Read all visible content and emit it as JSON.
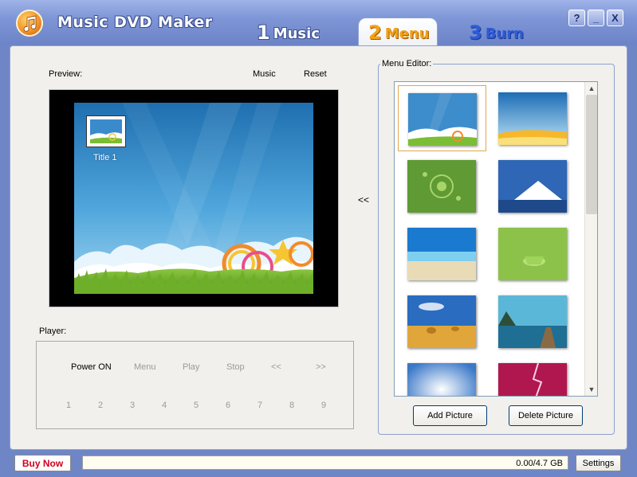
{
  "app": {
    "title": "Music DVD Maker"
  },
  "tabs": [
    {
      "num": "1",
      "label": "Music"
    },
    {
      "num": "2",
      "label": "Menu"
    },
    {
      "num": "3",
      "label": "Burn"
    }
  ],
  "window_controls": {
    "help": "?",
    "minimize": "_",
    "close": "X"
  },
  "preview": {
    "label": "Preview:",
    "music_link": "Music",
    "reset_link": "Reset",
    "title_item": "Title 1"
  },
  "move_arrow": "<<",
  "player": {
    "label": "Player:",
    "controls": [
      "Power ON",
      "Menu",
      "Play",
      "Stop",
      "<<",
      ">>"
    ],
    "numbers": [
      "1",
      "2",
      "3",
      "4",
      "5",
      "6",
      "7",
      "8",
      "9"
    ]
  },
  "menu_editor": {
    "label": "Menu Editor:",
    "thumbnails": [
      "sky-grass",
      "sky-sun",
      "green-circles",
      "mountain",
      "beach",
      "green-cup",
      "hay-field",
      "lake-dock",
      "bright-sky",
      "pink-lightning"
    ],
    "add_button": "Add Picture",
    "delete_button": "Delete Picture"
  },
  "status": {
    "buy_button": "Buy Now",
    "capacity": "0.00/4.7 GB",
    "settings_button": "Settings"
  },
  "colors": {
    "header": "#7e96d6",
    "active_tab_text": "#f2a116",
    "burn_tab_text": "#2f5bd8",
    "buy_text": "#d0001a"
  }
}
